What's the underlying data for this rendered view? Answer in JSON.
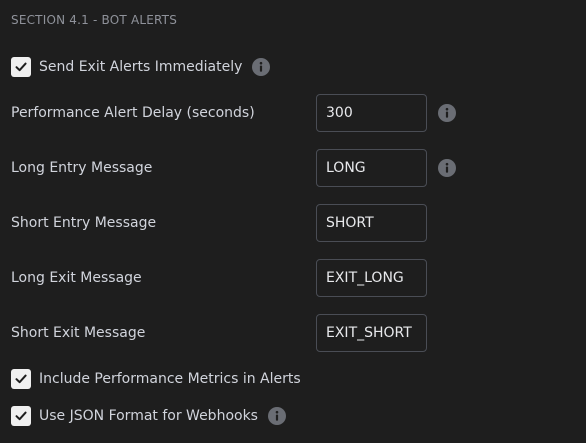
{
  "section": {
    "title": "SECTION 4.1 - BOT ALERTS"
  },
  "send_exit_alerts": {
    "label": "Send Exit Alerts Immediately",
    "checked": true,
    "info_icon": "info-icon"
  },
  "performance_alert_delay": {
    "label": "Performance Alert Delay (seconds)",
    "value": "300",
    "info_icon": "info-icon"
  },
  "long_entry_message": {
    "label": "Long Entry Message",
    "value": "LONG",
    "info_icon": "info-icon"
  },
  "short_entry_message": {
    "label": "Short Entry Message",
    "value": "SHORT"
  },
  "long_exit_message": {
    "label": "Long Exit Message",
    "value": "EXIT_LONG"
  },
  "short_exit_message": {
    "label": "Short Exit Message",
    "value": "EXIT_SHORT"
  },
  "include_performance_metrics": {
    "label": "Include Performance Metrics in Alerts",
    "checked": true
  },
  "use_json_format": {
    "label": "Use JSON Format for Webhooks",
    "checked": true,
    "info_icon": "info-icon"
  },
  "colors": {
    "background": "#1e1e1e",
    "text": "#d1d4dc",
    "muted_text": "#8f929a",
    "input_border": "#4a4d55",
    "checkbox_fill": "#f0f0f0",
    "info_icon": "#6a6d74"
  }
}
